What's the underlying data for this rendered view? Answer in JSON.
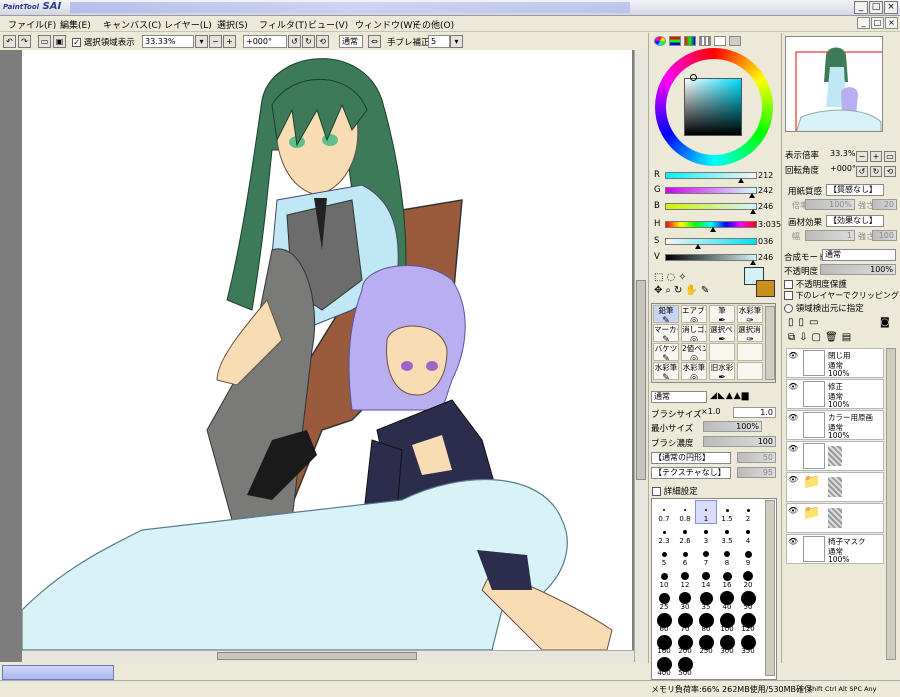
{
  "app": {
    "logo_small": "PaintTool",
    "logo_big": "SAI",
    "window_buttons": [
      "_",
      "□",
      "×"
    ]
  },
  "menu": {
    "items": [
      "ファイル(F)",
      "編集(E)",
      "キャンバス(C)",
      "レイヤー(L)",
      "選択(S)",
      "フィルタ(T)",
      "ビュー(V)",
      "ウィンドウ(W)",
      "その他(O)"
    ]
  },
  "toolbar": {
    "selection_label": "選択領域表示",
    "selection_checked": true,
    "zoom": "33.33%",
    "rotation": "+000°",
    "blend_mode": "通常",
    "stabilizer_label": "手ブレ補正",
    "stabilizer_value": "5"
  },
  "color": {
    "current_fg": "#d4f2f6",
    "current_bg": "#c8901c",
    "sliders": [
      {
        "label": "R",
        "value": "212",
        "level": 0.83
      },
      {
        "label": "G",
        "value": "242",
        "level": 0.95
      },
      {
        "label": "B",
        "value": "246",
        "level": 0.96
      },
      {
        "label": "H",
        "value": "3:035",
        "level": 0.52
      },
      {
        "label": "S",
        "value": "036",
        "level": 0.36
      },
      {
        "label": "V",
        "value": "246",
        "level": 0.96
      }
    ]
  },
  "tools": {
    "row1": [
      "鉛筆",
      "エアブラシ",
      "筆",
      "水彩筆"
    ],
    "row2": [
      "マーカー",
      "消しゴム",
      "選択ペン",
      "選択消し"
    ],
    "row3": [
      "バケツ",
      "2値ペン",
      "",
      ""
    ],
    "row4": [
      "水彩筆",
      "水彩筆",
      "旧水彩",
      ""
    ]
  },
  "brush": {
    "mode": "通常",
    "size_label": "ブラシサイズ",
    "size_multiplier": "×1.0",
    "size_value": "1.0",
    "min_size_label": "最小サイズ",
    "min_size_value": "100%",
    "density_label": "ブラシ濃度",
    "density_value": "100",
    "shape": "【通常の円形】",
    "shape_value": "50",
    "texture": "【テクスチャなし】",
    "texture_value": "95",
    "detail_label": "詳細設定",
    "size_presets": [
      "0.7",
      "0.8",
      "1",
      "1.5",
      "2",
      "2.3",
      "2.6",
      "3",
      "3.5",
      "4",
      "5",
      "6",
      "7",
      "8",
      "9",
      "10",
      "12",
      "14",
      "16",
      "20",
      "25",
      "30",
      "35",
      "40",
      "50",
      "60",
      "70",
      "80",
      "100",
      "120",
      "160",
      "200",
      "250",
      "300",
      "350",
      "400",
      "500"
    ]
  },
  "navigator": {
    "zoom_label": "表示倍率",
    "zoom_value": "33.3%",
    "angle_label": "回転角度",
    "angle_value": "+000°"
  },
  "layer_panel": {
    "paper_label": "用紙質感",
    "paper_value": "【質感なし】",
    "paper_sub1": "倍率",
    "paper_sub1_value": "100%",
    "paper_sub2": "強さ",
    "paper_sub2_value": "20",
    "effect_label": "画材効果",
    "effect_value": "【効果なし】",
    "effect_sub1": "幅",
    "effect_sub1_value": "1",
    "effect_sub2": "強さ",
    "effect_sub2_value": "100",
    "blend_label": "合成モード",
    "blend_value": "通常",
    "opacity_label": "不透明度",
    "opacity_value": "100%",
    "opt1": "不透明度保護",
    "opt2": "下のレイヤーでクリッピング",
    "opt3": "領域検出元に指定",
    "layers": [
      {
        "name": "閉じ用",
        "mode": "通常",
        "opacity": "100%",
        "folder": false
      },
      {
        "name": "修正",
        "mode": "通常",
        "opacity": "100%",
        "folder": false
      },
      {
        "name": "カラー用原画",
        "mode": "通常",
        "opacity": "100%",
        "folder": false
      },
      {
        "name": "",
        "mode": "",
        "opacity": "",
        "folder": false
      },
      {
        "name": "",
        "mode": "",
        "opacity": "",
        "folder": true
      },
      {
        "name": "",
        "mode": "",
        "opacity": "",
        "folder": true
      },
      {
        "name": "椅子マスク",
        "mode": "通常",
        "opacity": "100%",
        "folder": false
      }
    ]
  },
  "status": {
    "memory": "メモリ負荷率:66% 262MB使用/530MB確保",
    "keys": [
      "Shift",
      "Ctrl",
      "Alt",
      "SPC",
      "Any"
    ]
  }
}
